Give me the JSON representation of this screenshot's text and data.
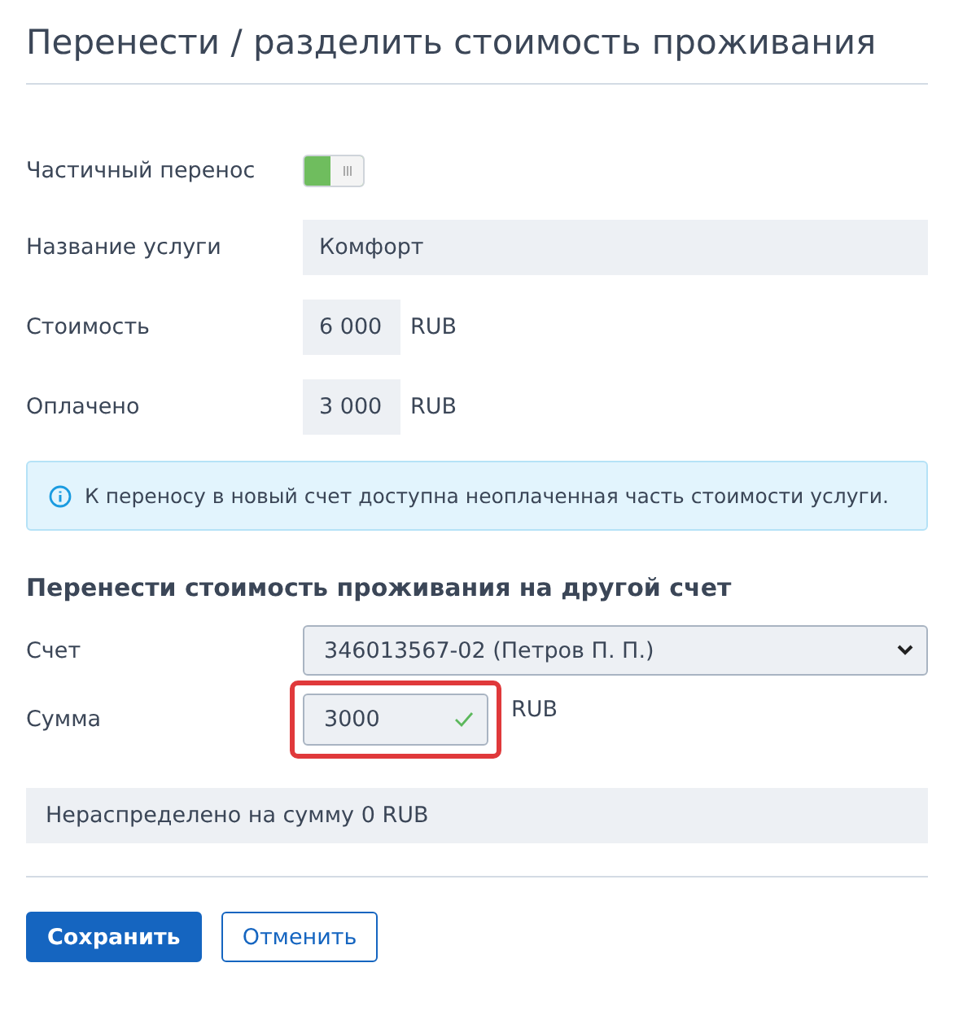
{
  "title": "Перенести / разделить стоимость проживания",
  "partial_transfer": {
    "label": "Частичный перенос",
    "on": true
  },
  "fields": [
    {
      "label": "Название услуги",
      "value": "Комфорт",
      "kind": "wide"
    },
    {
      "label": "Стоимость",
      "value": "6 000",
      "unit": "RUB",
      "kind": "amount"
    },
    {
      "label": "Оплачено",
      "value": "3 000",
      "unit": "RUB",
      "kind": "amount"
    }
  ],
  "info": "К переносу в новый счет доступна неоплаченная часть стоимости услуги.",
  "section_title": "Перенести стоимость проживания на другой счет",
  "account": {
    "label": "Счет",
    "value": "346013567-02 (Петров П. П.)"
  },
  "amount": {
    "label": "Сумма",
    "value": "3000",
    "unit": "RUB",
    "valid": true,
    "highlighted": true
  },
  "unallocated": "Нераспределено на сумму 0 RUB",
  "buttons": [
    {
      "label": "Сохранить",
      "kind": "primary"
    },
    {
      "label": "Отменить",
      "kind": "secondary"
    }
  ]
}
